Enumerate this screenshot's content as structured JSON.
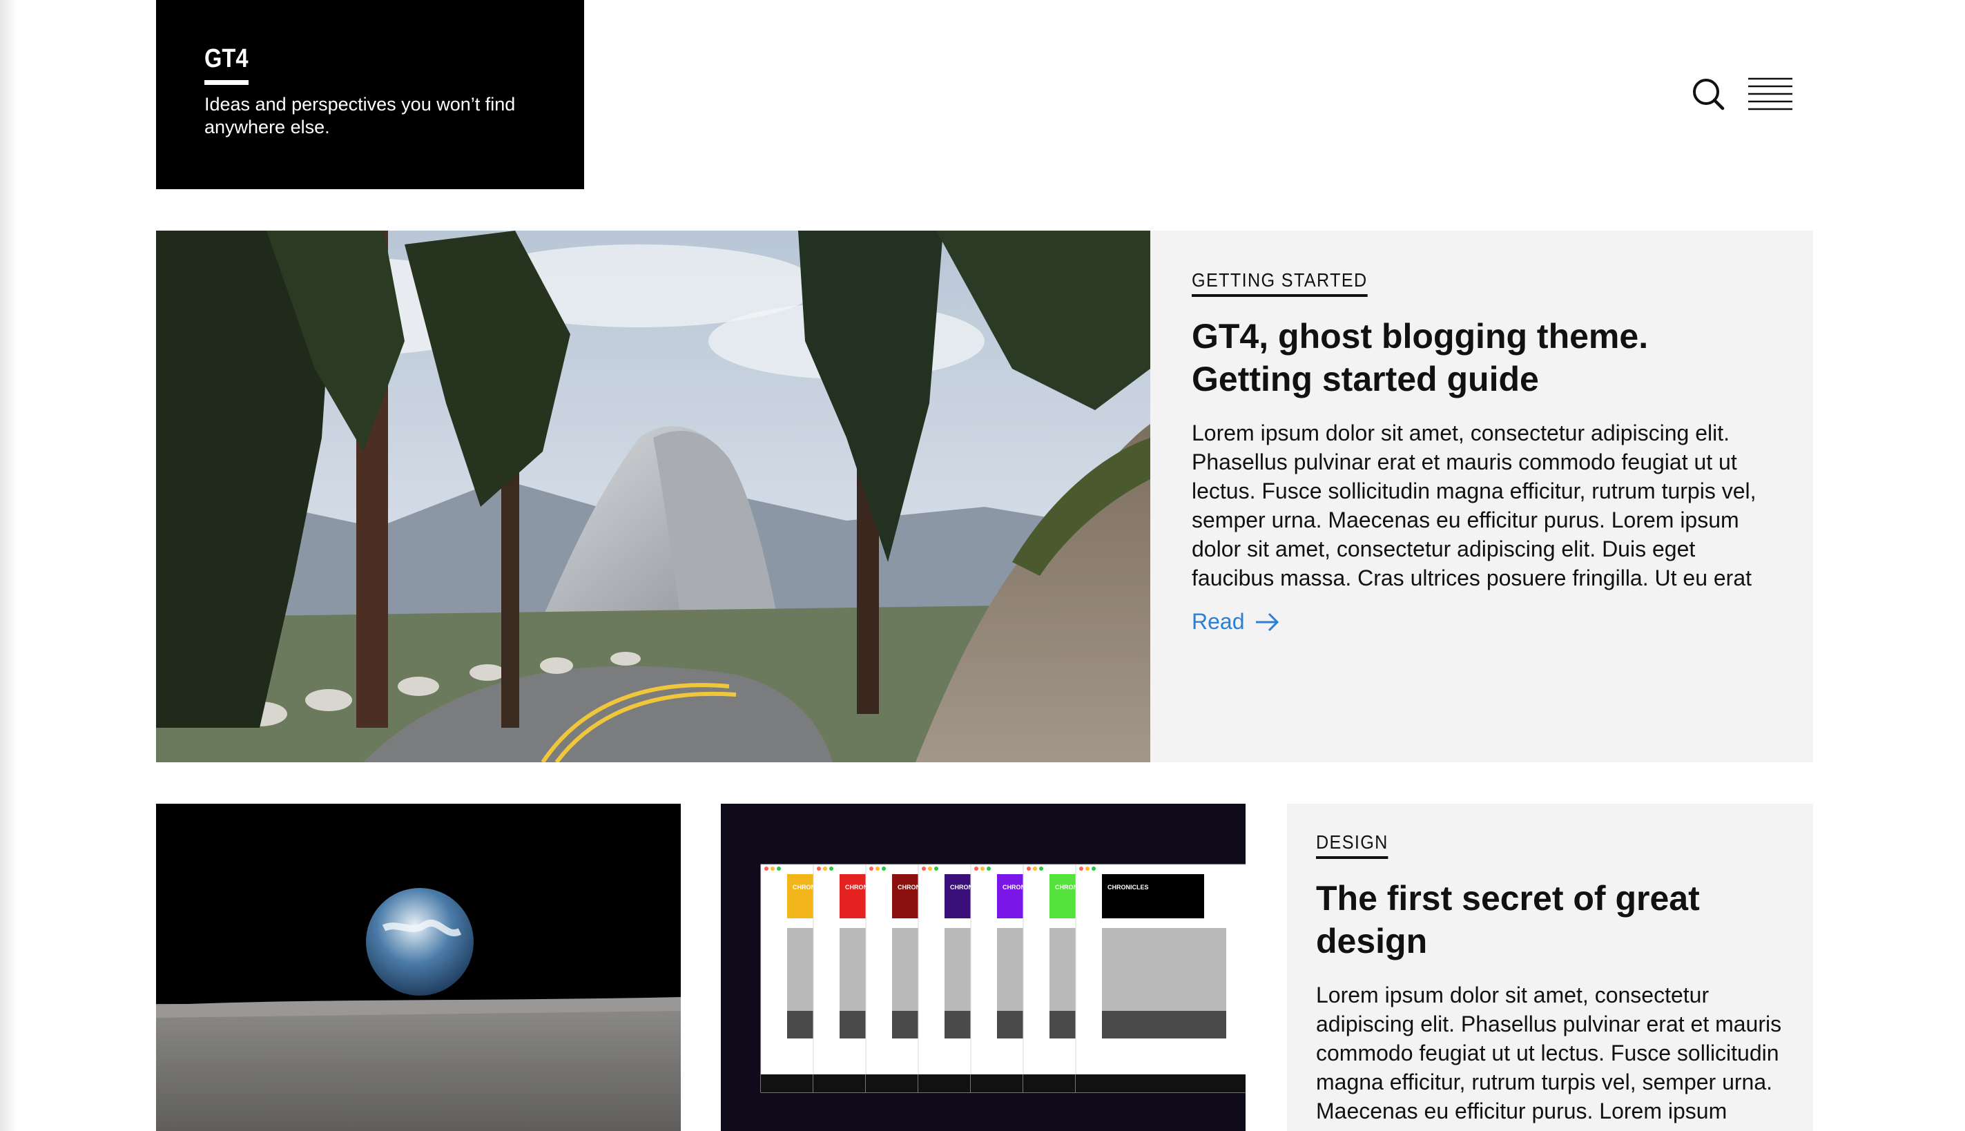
{
  "header": {
    "logo": "GT4",
    "tagline": "Ideas and perspectives you won’t find anywhere else.",
    "search_icon": "search-icon",
    "menu_icon": "hamburger-menu-icon"
  },
  "featured_post": {
    "category": "Getting Started",
    "title": "GT4, ghost blogging theme. Getting started guide",
    "excerpt": "Lorem ipsum dolor sit amet, consectetur adipiscing elit. Phasellus pulvinar erat et mauris commodo feugiat ut ut lectus. Fusce sollicitudin magna efficitur, rutrum turpis vel, semper urna. Maecenas eu efficitur purus. Lorem ipsum dolor sit amet, consectetur adipiscing elit. Duis eget faucibus massa. Cras ultrices posuere fringilla. Ut eu erat",
    "read_label": "Read",
    "read_icon": "arrow-right-icon"
  },
  "posts": [
    {
      "category": "Design",
      "title": "The first secret of great design",
      "excerpt": "Lorem ipsum dolor sit amet, consectetur adipiscing elit. Phasellus pulvinar erat et mauris commodo feugiat ut ut lectus. Fusce sollicitudin magna efficitur, rutrum turpis vel, semper urna. Maecenas eu efficitur purus. Lorem ipsum"
    }
  ],
  "theme_previews": {
    "label": "CHRONICLES",
    "accent_colors": [
      "#f2b51a",
      "#e52421",
      "#8b1010",
      "#3a0f7a",
      "#7a17e8",
      "#55e23c",
      "#000000"
    ]
  },
  "colors": {
    "link": "#2b7fd6",
    "card_bg": "#f3f3f3",
    "brand_bg": "#000000"
  }
}
